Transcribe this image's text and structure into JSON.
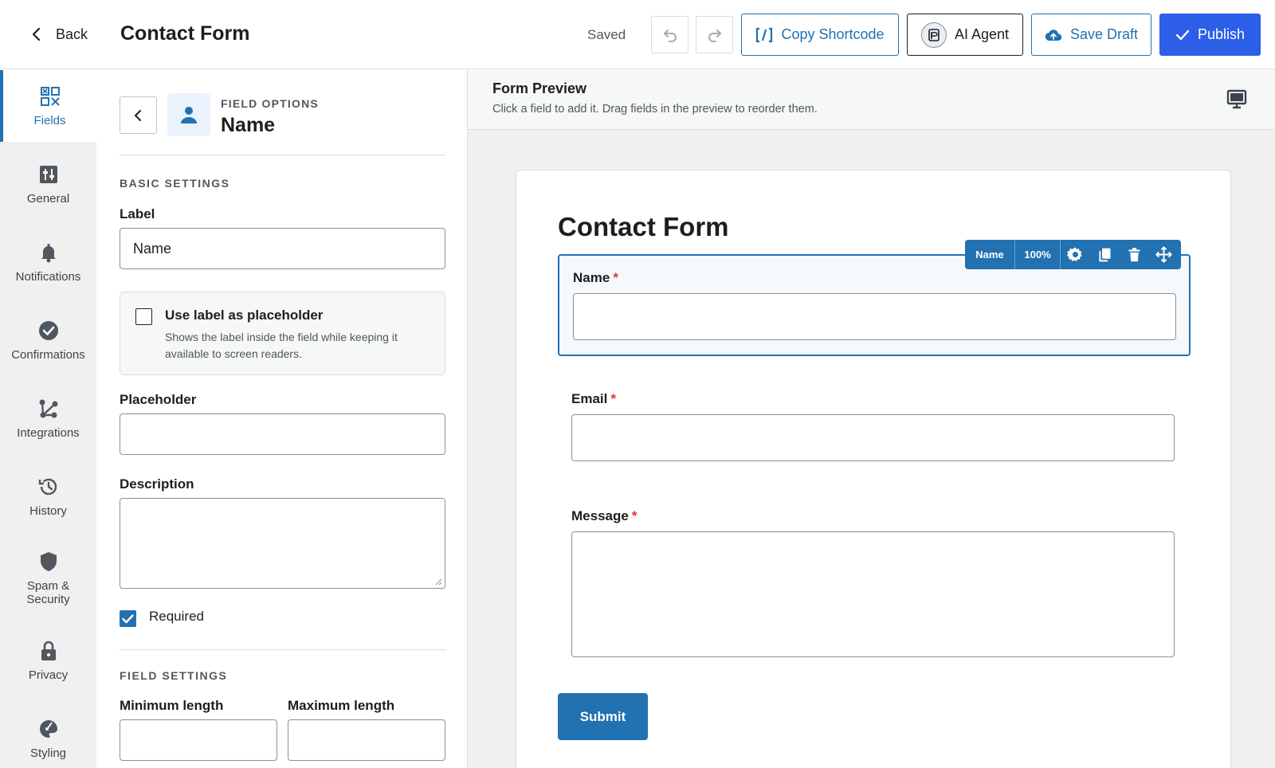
{
  "header": {
    "back_label": "Back",
    "title": "Contact Form",
    "status": "Saved",
    "copy_shortcode_label": "Copy Shortcode",
    "ai_agent_label": "AI Agent",
    "save_draft_label": "Save Draft",
    "publish_label": "Publish"
  },
  "nav": {
    "items": [
      {
        "label": "Fields",
        "icon": "fields-icon",
        "active": true
      },
      {
        "label": "General",
        "icon": "sliders-icon"
      },
      {
        "label": "Notifications",
        "icon": "bell-icon"
      },
      {
        "label": "Confirmations",
        "icon": "check-circle-icon"
      },
      {
        "label": "Integrations",
        "icon": "integrations-icon"
      },
      {
        "label": "History",
        "icon": "history-icon"
      },
      {
        "label": "Spam & Security",
        "icon": "shield-icon"
      },
      {
        "label": "Privacy",
        "icon": "lock-icon"
      },
      {
        "label": "Styling",
        "icon": "palette-icon"
      }
    ]
  },
  "panel": {
    "kicker": "FIELD OPTIONS",
    "field_name": "Name",
    "basic_settings": "BASIC SETTINGS",
    "label_label": "Label",
    "label_value": "Name",
    "use_label_title": "Use label as placeholder",
    "use_label_desc": "Shows the label inside the field while keeping it available to screen readers.",
    "placeholder_label": "Placeholder",
    "placeholder_value": "",
    "description_label": "Description",
    "description_value": "",
    "required_label": "Required",
    "required_checked": true,
    "field_settings": "FIELD SETTINGS",
    "min_length_label": "Minimum length",
    "max_length_label": "Maximum length"
  },
  "preview": {
    "title": "Form Preview",
    "subtitle": "Click a field to add it. Drag fields in the preview to reorder them.",
    "form_title": "Contact Form",
    "toolbar": {
      "name": "Name",
      "width": "100%"
    },
    "fields": [
      {
        "label": "Name",
        "required": "*"
      },
      {
        "label": "Email",
        "required": "*"
      },
      {
        "label": "Message",
        "required": "*"
      }
    ],
    "submit_label": "Submit"
  },
  "colors": {
    "accent": "#2271b1",
    "publish": "#2c5ee8",
    "required": "#d63638"
  }
}
